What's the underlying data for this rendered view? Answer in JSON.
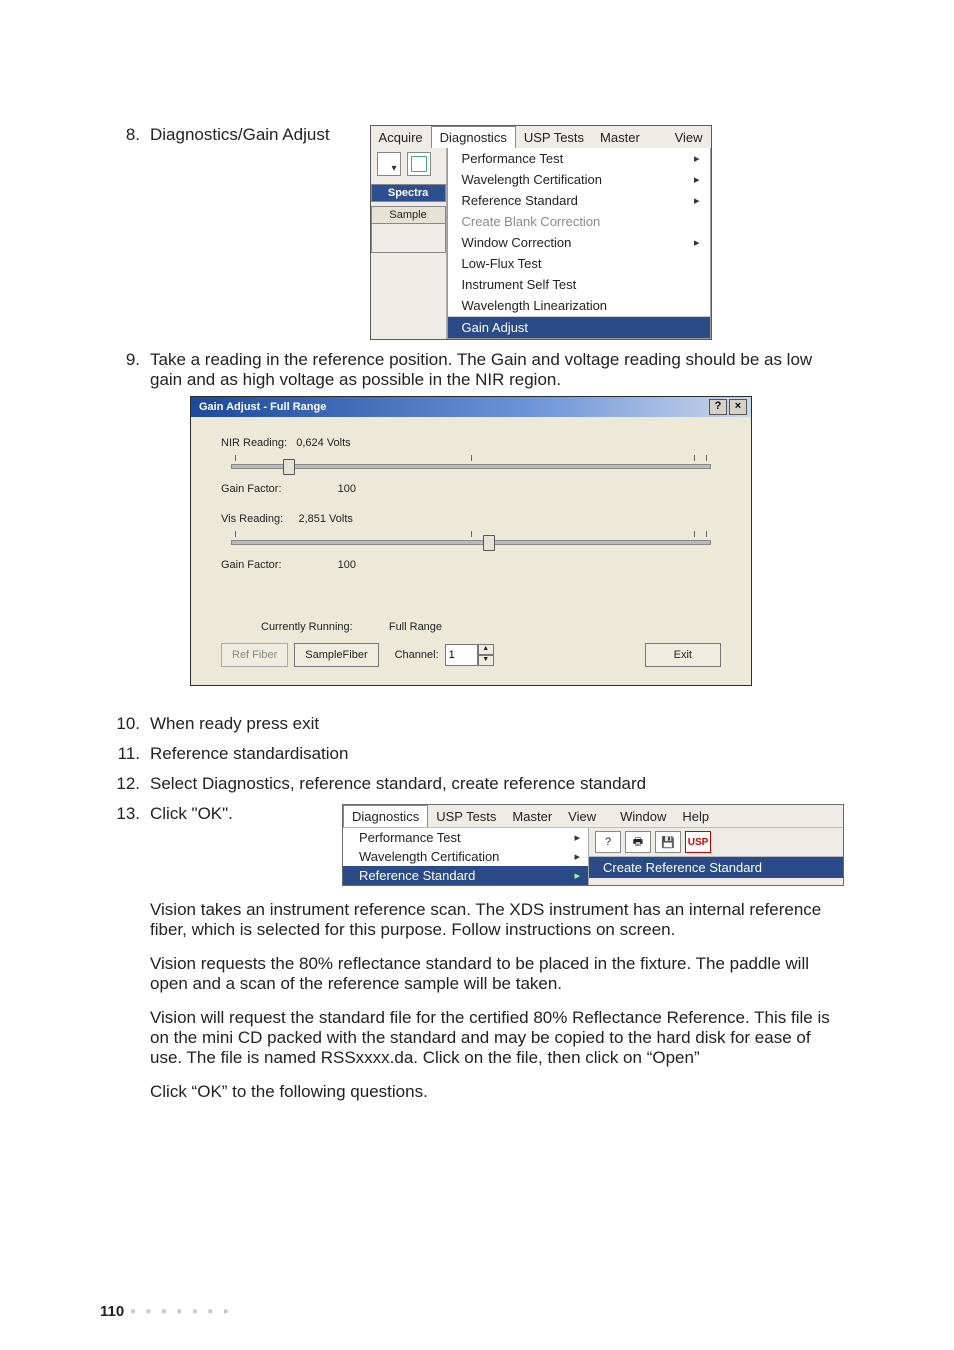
{
  "items": {
    "i8": {
      "num": "8.",
      "text": "Diagnostics/Gain Adjust"
    },
    "i9": {
      "num": "9.",
      "text": "Take a reading in the reference position. The Gain and voltage reading should be as low gain and as high voltage as possible in the NIR region."
    },
    "i10": {
      "num": "10.",
      "text": "When ready press exit"
    },
    "i11": {
      "num": "11.",
      "text": "Reference standardisation"
    },
    "i12": {
      "num": "12.",
      "text": "Select Diagnostics, reference standard, create reference standard"
    },
    "i13": {
      "num": "13.",
      "text": "Click \"OK\"."
    }
  },
  "menu1": {
    "bar": {
      "acquire": "Acquire",
      "diagnostics": "Diagnostics",
      "usp": "USP Tests",
      "master": "Master",
      "view": "View"
    },
    "left": {
      "spectra": "Spectra",
      "sample": "Sample"
    },
    "dd": {
      "perf": "Performance Test",
      "wave": "Wavelength Certification",
      "ref": "Reference Standard",
      "blank": "Create Blank Correction",
      "winc": "Window Correction",
      "low": "Low-Flux Test",
      "self": "Instrument Self Test",
      "lin": "Wavelength Linearization",
      "gain": "Gain Adjust"
    }
  },
  "dlg": {
    "title": "Gain Adjust - Full Range",
    "nir_lbl": "NIR Reading:",
    "nir_val": "0,624 Volts",
    "gf_lbl": "Gain Factor:",
    "gf_val": "100",
    "vis_lbl": "Vis Reading:",
    "vis_val": "2,851 Volts",
    "gf2_val": "100",
    "cur_lbl": "Currently Running:",
    "cur_val": "Full Range",
    "ref_btn": "Ref Fiber",
    "sample_btn": "SampleFiber",
    "chan_lbl": "Channel:",
    "chan_val": "1",
    "exit": "Exit",
    "help": "?",
    "close": "×"
  },
  "menu2": {
    "bar": {
      "diagnostics": "Diagnostics",
      "usp": "USP Tests",
      "master": "Master",
      "view": "View",
      "window": "Window",
      "help": "Help"
    },
    "left": {
      "perf": "Performance Test",
      "wave": "Wavelength Certification",
      "ref": "Reference Standard"
    },
    "usp_btn": "USP",
    "sub": "Create Reference Standard"
  },
  "paras": {
    "p1": "Vision takes an instrument reference scan. The XDS instrument has an internal reference fiber, which is selected for this purpose. Follow instructions on screen.",
    "p2": "Vision requests the 80% reflectance standard to be placed in the fixture. The paddle will open and a scan of the reference sample will be taken.",
    "p3": "Vision will request the standard file for the certified 80% Reflectance Reference. This file is on the mini CD packed with the standard and may be copied to the hard disk for ease of use. The file is named RSSxxxx.da. Click on the file, then click on “Open”",
    "p4": "Click “OK” to the following questions."
  },
  "page_number": "110",
  "dots": "▪ ▪ ▪ ▪ ▪ ▪ ▪"
}
